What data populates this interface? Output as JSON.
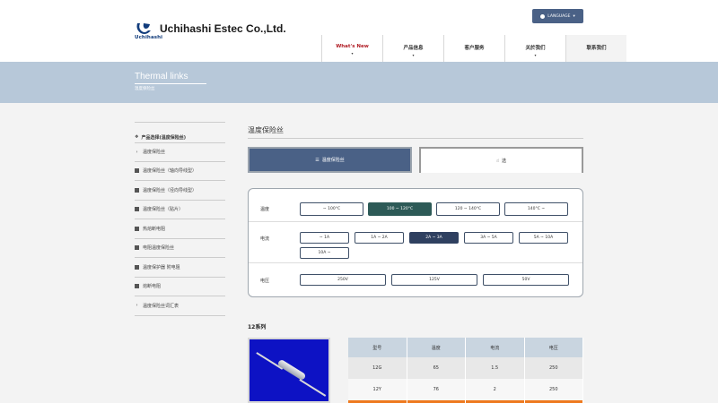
{
  "header": {
    "company_name": "Uchihashi Estec Co.,Ltd.",
    "logo_sub": "Uchihashi",
    "language_label": "LANGUAGE",
    "nav": [
      {
        "label": "What's New",
        "arrow": "▾"
      },
      {
        "label": "产品信息",
        "arrow": "▾"
      },
      {
        "label": "客户服务",
        "arrow": ""
      },
      {
        "label": "关於我们",
        "arrow": "▾"
      },
      {
        "label": "联系我们",
        "arrow": ""
      }
    ]
  },
  "banner": {
    "title": "Thermal links",
    "subtitle": "温度保险丝"
  },
  "sidebar": {
    "heading": "产品选择(温度保险丝)",
    "items": [
      {
        "label": "温度保险丝",
        "icon": "chevron"
      },
      {
        "label": "温度保险丝（轴向导线型）",
        "icon": "plus"
      },
      {
        "label": "温度保险丝（径向导线型）",
        "icon": "plus"
      },
      {
        "label": "温度保险丝（贴片）",
        "icon": "plus"
      },
      {
        "label": "热熔断电阻",
        "icon": "plus"
      },
      {
        "label": "电阻温度保险丝",
        "icon": "plus"
      },
      {
        "label": "温度保护器 附电阻",
        "icon": "plus"
      },
      {
        "label": "熔断电阻",
        "icon": "plus"
      },
      {
        "label": "温度保险丝词汇表",
        "icon": "chevron"
      }
    ]
  },
  "main": {
    "title": "温度保险丝",
    "tabs": [
      {
        "label": "温度保险丝",
        "icon": "list-icon"
      },
      {
        "label": "选",
        "icon": "hand-pointer-icon"
      }
    ],
    "filters": {
      "temperature": {
        "label": "温度",
        "options": [
          "~ 100°C",
          "100 ~ 120°C",
          "120 ~ 140°C",
          "140°C ~"
        ],
        "selected": "100 ~ 120°C"
      },
      "current": {
        "label": "电流",
        "options": [
          "~ 1A",
          "1A ~ 2A",
          "2A ~ 3A",
          "3A ~ 5A",
          "5A ~ 10A",
          "10A ~"
        ],
        "selected": "2A ~ 3A"
      },
      "voltage": {
        "label": "电压",
        "options": [
          "250V",
          "125V",
          "50V"
        ]
      }
    },
    "series": {
      "title": "12系列",
      "table": {
        "headers": [
          "型号",
          "温度",
          "电流",
          "电压"
        ],
        "rows": [
          [
            "12G",
            "65",
            "1.5",
            "250"
          ],
          [
            "12Y",
            "76",
            "2",
            "250"
          ],
          [
            "",
            "",
            "",
            ""
          ]
        ]
      }
    }
  },
  "colors": {
    "brand_navy": "#4a6186",
    "banner": "#b7c8d9",
    "selected_green": "#2d5a57",
    "selected_navy": "#2f4060",
    "highlight_orange": "#ee7a1f",
    "product_bg": "#0d12c4"
  }
}
